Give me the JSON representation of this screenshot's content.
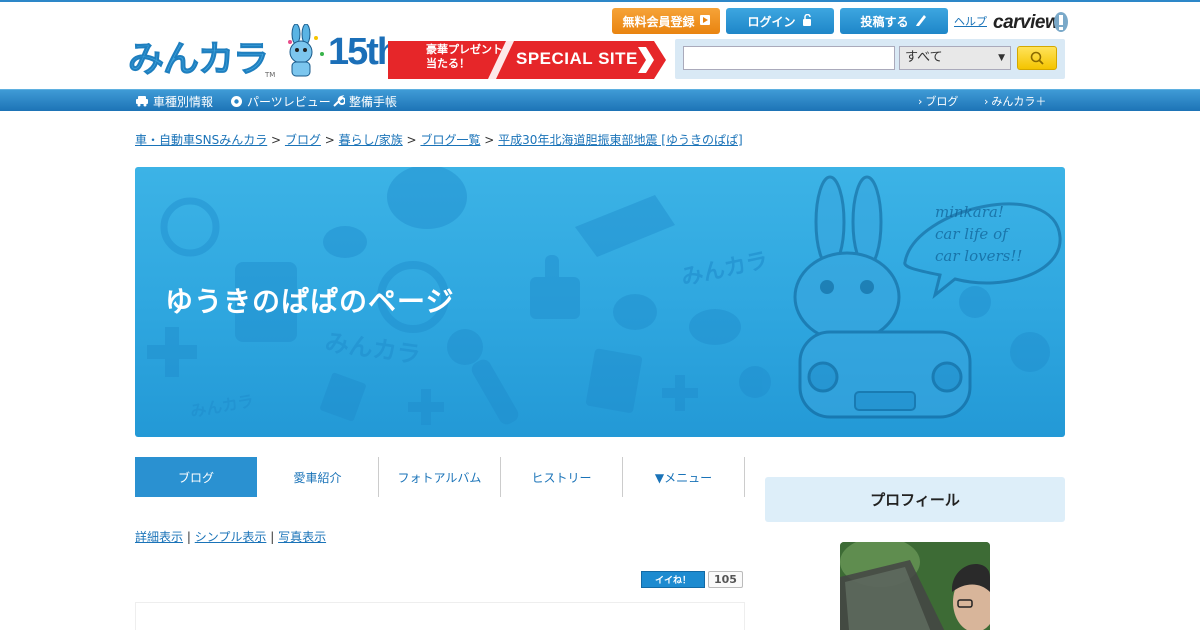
{
  "header": {
    "logo": "みんカラ",
    "logo_tm": "TM",
    "anniversary": "15th",
    "promo": {
      "sub_line1": "豪華プレゼント",
      "sub_line2": "当たる！",
      "main": "SPECIAL SITE"
    },
    "buttons": {
      "register": "無料会員登録",
      "login": "ログイン",
      "post": "投稿する"
    },
    "help": "ヘルプ",
    "carview": "carview",
    "search": {
      "value": "",
      "select_value": "すべて"
    }
  },
  "nav": {
    "left": [
      "車種別情報",
      "パーツレビュー",
      "整備手帳"
    ],
    "right": [
      "ブログ",
      "みんカラ＋"
    ]
  },
  "breadcrumb": {
    "items": [
      "車・自動車SNSみんカラ",
      "ブログ",
      "暮らし/家族",
      "ブログ一覧",
      "平成30年北海道胆振東部地震 [ゆうきのぱぱ]"
    ],
    "separator": ">"
  },
  "banner": {
    "title": "ゆうきのぱぱのページ",
    "bubble_text": [
      "minkara!",
      "car life of",
      "car lovers!!"
    ],
    "stamp": "みんカラ"
  },
  "tabs": [
    {
      "label": "ブログ",
      "active": true
    },
    {
      "label": "愛車紹介",
      "active": false
    },
    {
      "label": "フォトアルバム",
      "active": false
    },
    {
      "label": "ヒストリー",
      "active": false
    },
    {
      "label": "▼メニュー",
      "active": false
    }
  ],
  "view_links": {
    "detail": "詳細表示",
    "simple": "シンプル表示",
    "photo": "写真表示",
    "separator": "|"
  },
  "iine": {
    "label": "イイね！",
    "count": "105"
  },
  "sidebar": {
    "profile_title": "プロフィール"
  },
  "colors": {
    "brand_blue": "#2a91d1",
    "nav_blue": "#1d73b6",
    "register_orange": "#e98410",
    "search_yellow": "#f4c400"
  }
}
